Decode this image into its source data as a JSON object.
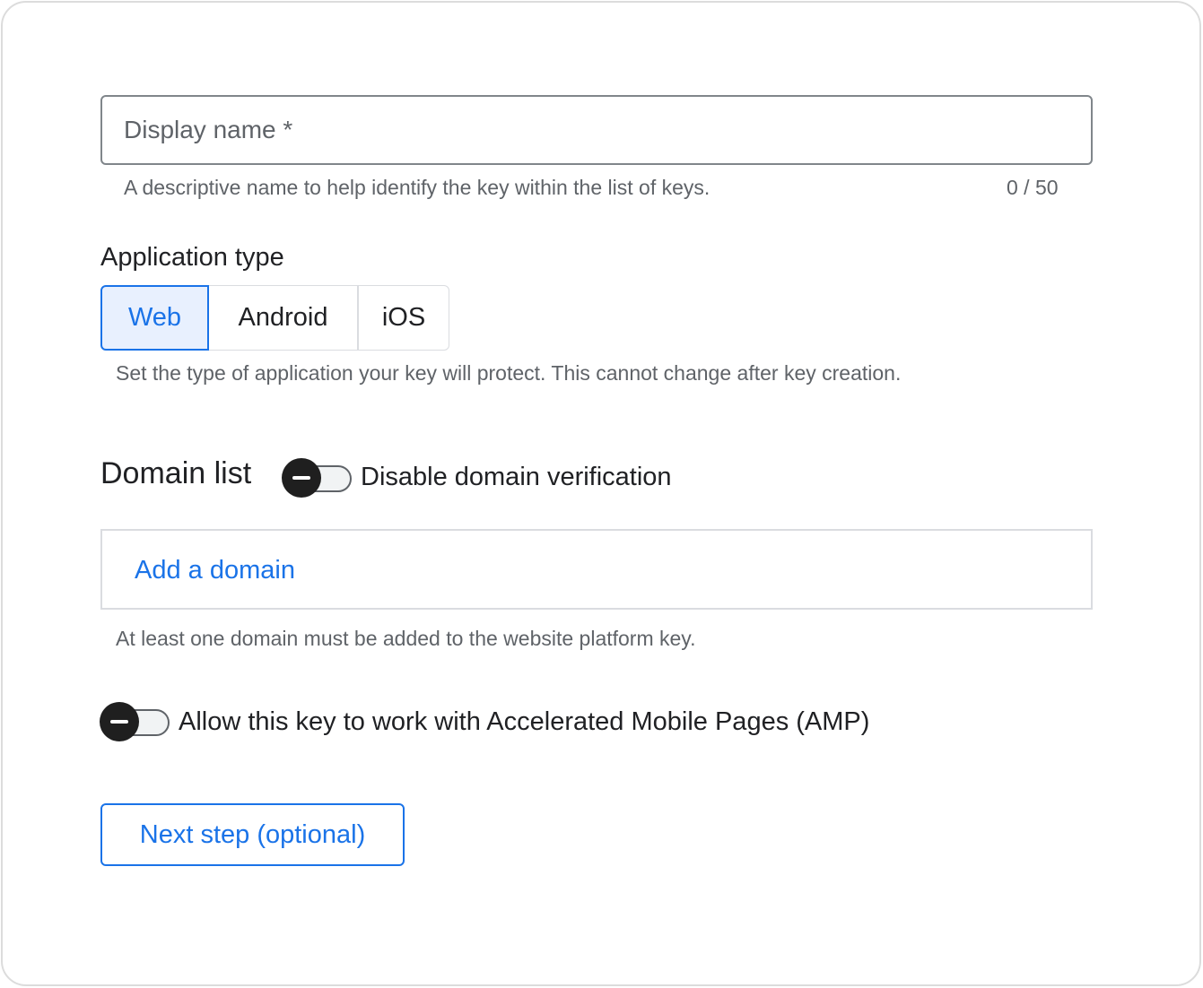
{
  "display_name_field": {
    "placeholder": "Display name *",
    "value": "",
    "hint": "A descriptive name to help identify the key within the list of keys.",
    "counter": "0 / 50"
  },
  "application_type": {
    "title": "Application type",
    "options": [
      {
        "label": "Web",
        "selected": true
      },
      {
        "label": "Android",
        "selected": false
      },
      {
        "label": "iOS",
        "selected": false
      }
    ],
    "hint": "Set the type of application your key will protect. This cannot change after key creation."
  },
  "domain_list": {
    "title": "Domain list",
    "toggle": {
      "label": "Disable domain verification",
      "on": false
    },
    "add_link": "Add a domain",
    "hint": "At least one domain must be added to the website platform key."
  },
  "amp_toggle": {
    "label": "Allow this key to work with Accelerated Mobile Pages (AMP)",
    "on": false
  },
  "next_button": {
    "label": "Next step (optional)"
  },
  "colors": {
    "accent": "#1a73e8",
    "selected_bg": "#e8f0fe",
    "hint_text": "#5f6368",
    "toggle_thumb": "#1f1f1f"
  }
}
